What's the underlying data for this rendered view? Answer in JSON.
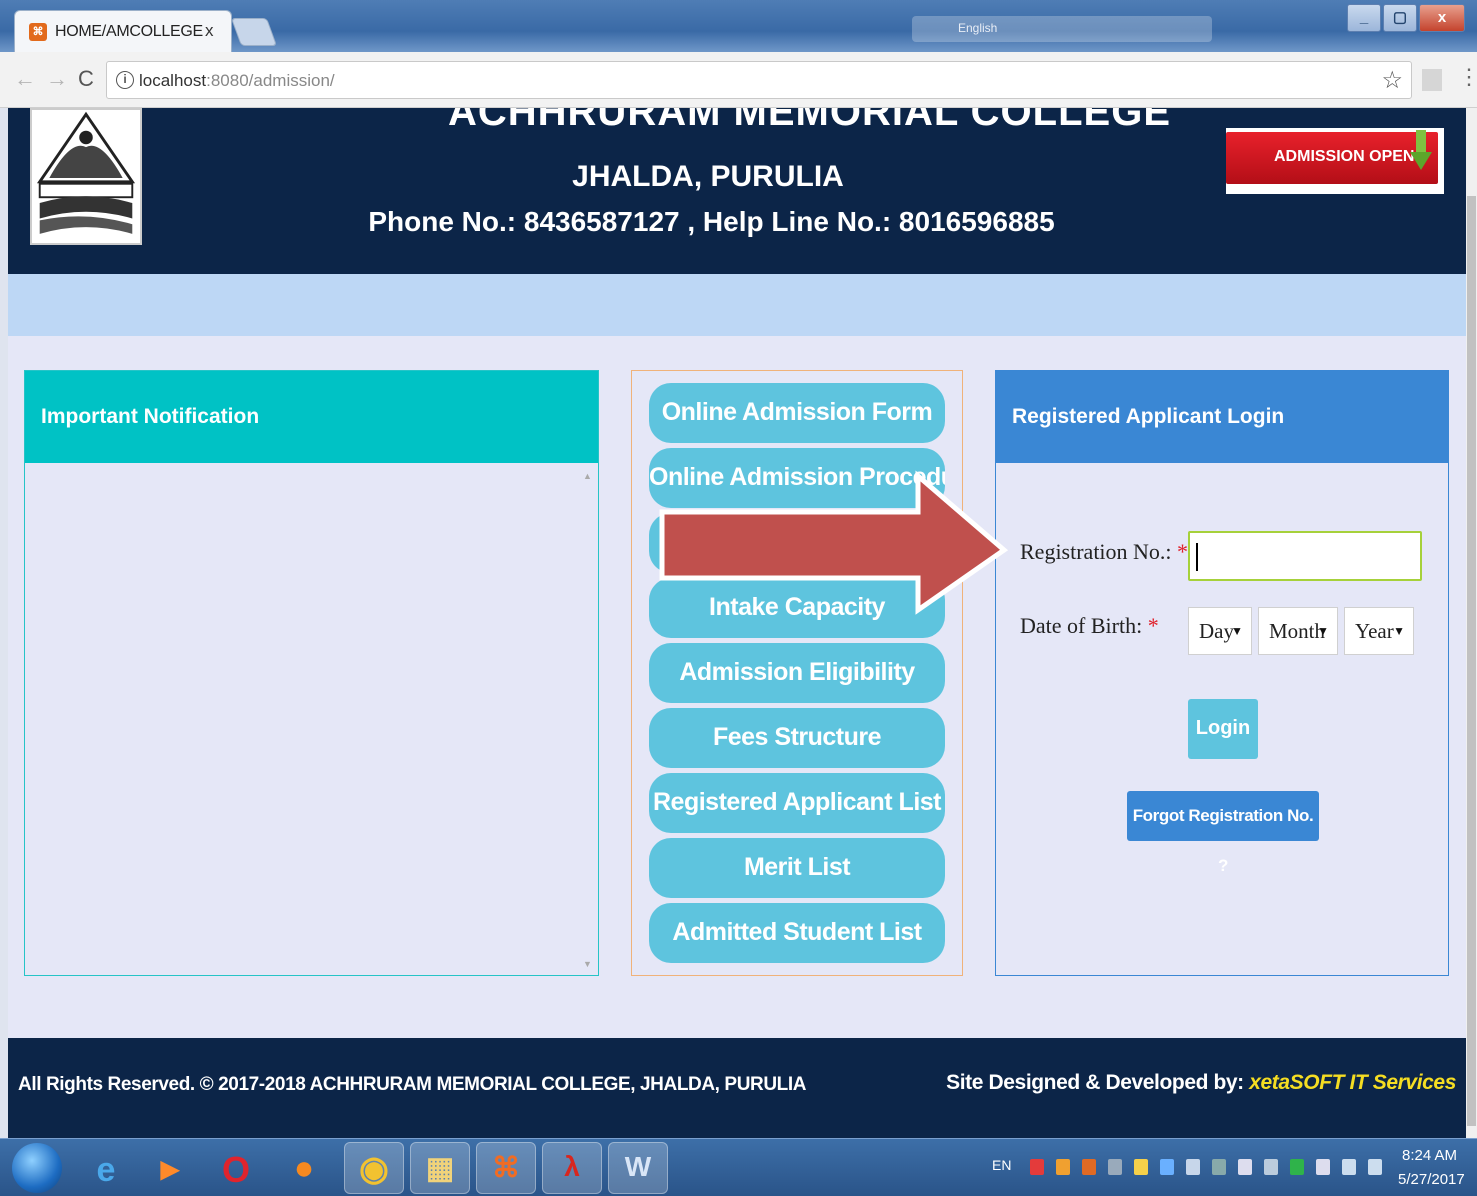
{
  "browser": {
    "tab_title": "HOME/AMCOLLEGE",
    "tab_close": "x",
    "url_host": "localhost",
    "url_path": ":8080/admission/",
    "tray_text": "English",
    "window_buttons": [
      "_",
      "▢",
      "x"
    ]
  },
  "header": {
    "college_name": "ACHHRURAM MEMORIAL COLLEGE",
    "location": "JHALDA, PURULIA",
    "phone_line": "Phone No.: 8436587127 , Help Line No.: 8016596885",
    "admission_badge": "ADMISSION OPEN"
  },
  "notification": {
    "title": "Important Notification"
  },
  "menu": {
    "items": [
      "Online Admission Form",
      "Online Admission Procedure",
      "",
      "Intake Capacity",
      "Admission Eligibility",
      "Fees Structure",
      "Registered Applicant List",
      "Merit List",
      "Admitted Student List"
    ]
  },
  "login": {
    "title": "Registered Applicant Login",
    "reg_label": "Registration No.:",
    "dob_label": "Date of Birth:",
    "required_mark": "*",
    "reg_value": "",
    "day_value": "Day",
    "month_value": "Month",
    "year_value": "Year",
    "login_button": "Login",
    "forgot_button": "Forgot Registration No. ?"
  },
  "footer": {
    "rights": "All Rights Reserved. © 2017-2018 ACHHRURAM MEMORIAL COLLEGE, JHALDA, PURULIA",
    "developed_by": "Site Designed & Developed by:",
    "developer": "xetaSOFT IT Services"
  },
  "taskbar": {
    "language": "EN",
    "time": "8:24 AM",
    "date": "5/27/2017"
  },
  "colors": {
    "header_bg": "#0c2548",
    "notification_head": "#00c2c5",
    "menu_button": "#5ec4de",
    "login_head": "#3a87d4",
    "arrow": "#c0504d"
  }
}
